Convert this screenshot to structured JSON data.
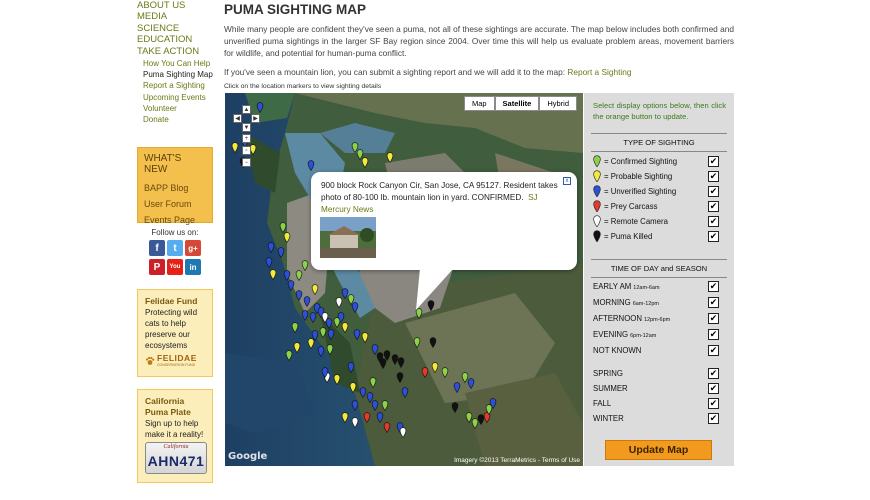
{
  "nav": {
    "main": [
      "ABOUT US",
      "MEDIA",
      "SCIENCE",
      "EDUCATION",
      "TAKE ACTION"
    ],
    "sub": [
      "How You Can Help",
      "Puma Sighting Map",
      "Report a Sighting",
      "Upcoming Events",
      "Volunteer",
      "Donate"
    ]
  },
  "whats_new": {
    "header": "WHAT'S NEW",
    "links": [
      "BAPP Blog",
      "User Forum",
      "Events Page"
    ]
  },
  "follow": {
    "title": "Follow us on:",
    "icons": [
      "facebook-icon",
      "twitter-icon",
      "google-plus-icon",
      "pinterest-icon",
      "youtube-icon",
      "linkedin-icon"
    ]
  },
  "felidae": {
    "header": "Felidae Fund",
    "text": "Protecting wild cats to help preserve our ecosystems",
    "logo": "FELIDAE",
    "logo_sub": "CONSERVATION FUND"
  },
  "plate": {
    "header": "California Puma Plate",
    "text": "Sign up to help make it a reality!",
    "plate_state": "California",
    "plate_number": "AHN471"
  },
  "main": {
    "title": "PUMA SIGHTING MAP",
    "intro": "While many people are confident they've seen a puma, not all of these sightings are accurate. The map below includes both confirmed and unverified puma sightings in the larger SF Bay region since 2004. Over time this will help us evaluate problem areas, movement barriers for wildlife, and potential for human-puma conflict.",
    "report_prefix": "If you've seen a mountain lion, you can submit a sighting report and we will add it to the map:",
    "report_link": "Report a Sighting",
    "hint": "Click on the location markers to view sighting details"
  },
  "map": {
    "types": [
      "Map",
      "Satellite",
      "Hybrid"
    ],
    "selected_type": "Satellite",
    "zoom_in": "+",
    "zoom_out": "−",
    "credits": "Imagery ©2013 TerraMetrics - Terms of Use",
    "google": "Google",
    "popup": {
      "text": "900 block Rock Canyon Cir, San Jose, CA 95127.  Resident takes photo of 80-100 lb. mountain lion in yard. CONFIRMED.",
      "link": "SJ Mercury News",
      "close": "x"
    },
    "marker_colors": {
      "green": "#8bd14a",
      "yellow": "#f2ea3a",
      "blue": "#2c50d8",
      "red": "#e43a2e",
      "white": "#ffffff",
      "black": "#111111"
    }
  },
  "panel": {
    "instructions": "Select display options below, then click the orange button to update.",
    "type_header": "TYPE OF SIGHTING",
    "types": [
      {
        "label": "= Confirmed Sighting",
        "color": "#8bd14a",
        "checked": true
      },
      {
        "label": "= Probable Sighting",
        "color": "#f2ea3a",
        "checked": true
      },
      {
        "label": "= Unverified Sighting",
        "color": "#2c50d8",
        "checked": true
      },
      {
        "label": "= Prey Carcass",
        "color": "#e43a2e",
        "checked": true
      },
      {
        "label": "= Remote Camera",
        "color": "#ffffff",
        "checked": true
      },
      {
        "label": "= Puma Killed",
        "color": "#111111",
        "checked": true
      }
    ],
    "time_header": "TIME OF DAY and SEASON",
    "times": [
      {
        "label": "EARLY AM",
        "range": "12am-6am",
        "checked": true
      },
      {
        "label": "MORNING",
        "range": "6am-12pm",
        "checked": true
      },
      {
        "label": "AFTERNOON",
        "range": "12pm-6pm",
        "checked": true
      },
      {
        "label": "EVENING",
        "range": "6pm-12am",
        "checked": true
      },
      {
        "label": "NOT KNOWN",
        "range": "",
        "checked": true
      }
    ],
    "seasons": [
      {
        "label": "SPRING",
        "checked": true
      },
      {
        "label": "SUMMER",
        "checked": true
      },
      {
        "label": "FALL",
        "checked": true
      },
      {
        "label": "WINTER",
        "checked": true
      }
    ],
    "check_mark": "✔",
    "update_label": "Update Map"
  }
}
